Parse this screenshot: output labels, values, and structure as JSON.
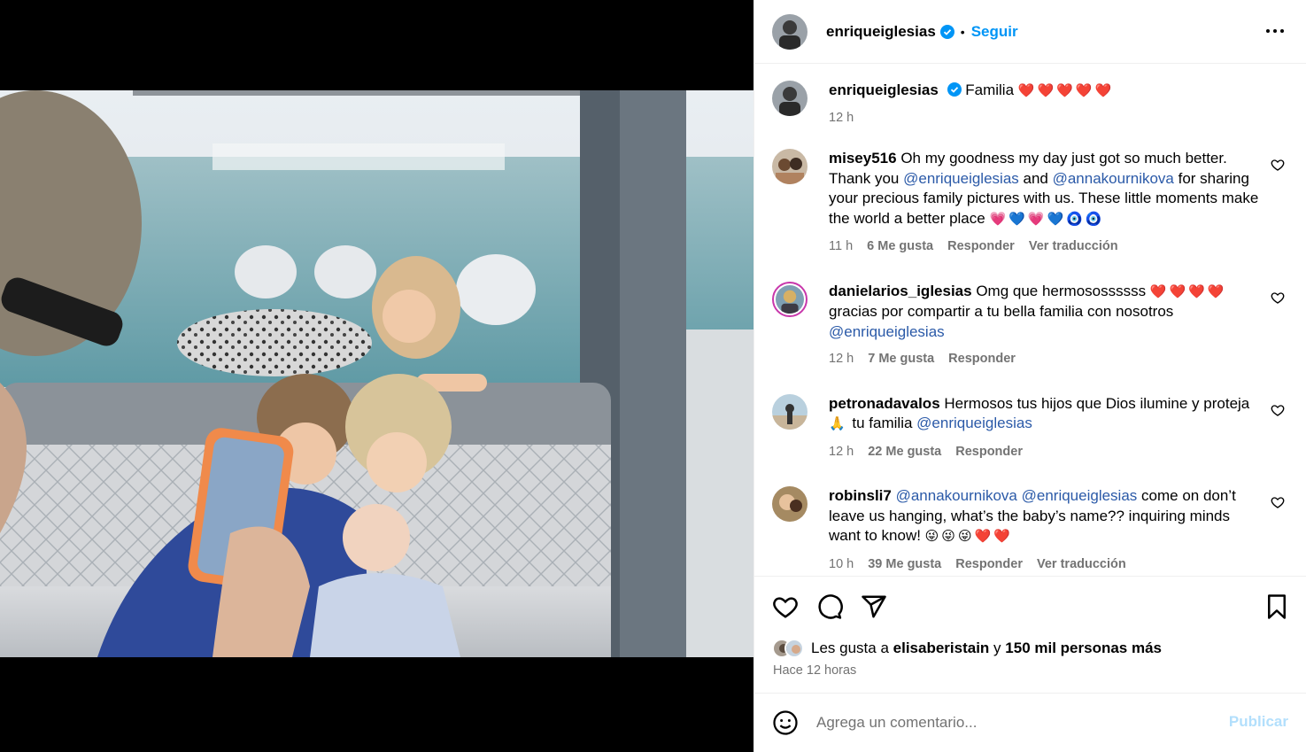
{
  "post": {
    "author": "enriqueiglesias",
    "follow_label": "Seguir",
    "dot": "•"
  },
  "caption": {
    "username": "enriqueiglesias",
    "text": "Familia",
    "emojis": "❤️❤️❤️❤️❤️",
    "time": "12 h"
  },
  "comments": [
    {
      "username": "misey516",
      "parts": [
        "Oh my goodness my day just got so much better. Thank you ",
        "@enriqueiglesias",
        " and ",
        "@annakournikova",
        " for sharing your precious family pictures with us. These little moments make the world a better place "
      ],
      "emojis": "💗💙💗💙🧿🧿",
      "time": "11 h",
      "likes": "6 Me gusta",
      "reply": "Responder",
      "translate": "Ver traducción"
    },
    {
      "username": "danielarios_iglesias",
      "parts": [
        "Omg que hermosossssss "
      ],
      "emojis": "❤️❤️❤️❤️",
      "parts2": [
        "gracias por compartir a tu bella familia con nosotros "
      ],
      "mention": "@enriqueiglesias",
      "time": "12 h",
      "likes": "7 Me gusta",
      "reply": "Responder"
    },
    {
      "username": "petronadavalos",
      "text": "Hermosos tus hijos que Dios ilumine y proteja",
      "emojis": "🙏",
      "text2": " tu familia ",
      "mention": "@enriqueiglesias",
      "time": "12 h",
      "likes": "22 Me gusta",
      "reply": "Responder"
    },
    {
      "username": "robinsli7",
      "mention1": "@annakournikova",
      "mention2": "@enriqueiglesias",
      "text": " come on don’t leave us hanging, what’s the baby’s name?? inquiring minds want to know! ",
      "emojis": "😜😜😜❤️❤️",
      "time": "10 h",
      "likes": "39 Me gusta",
      "reply": "Responder",
      "translate": "Ver traducción"
    }
  ],
  "likes": {
    "prefix": "Les gusta a",
    "user": "elisaberistain",
    "conj": "y",
    "count": "150 mil personas más"
  },
  "time_ago": "Hace 12 horas",
  "add_comment": {
    "placeholder": "Agrega un comentario...",
    "publish": "Publicar"
  },
  "colors": {
    "link": "#0095f6",
    "muted": "#737373",
    "heart": "#e0245e",
    "publish_disabled": "#b2dffc"
  },
  "icons": [
    "verified-badge-icon",
    "more-options-icon",
    "heart-outline-icon",
    "comment-icon",
    "share-icon",
    "bookmark-icon",
    "emoji-icon"
  ]
}
